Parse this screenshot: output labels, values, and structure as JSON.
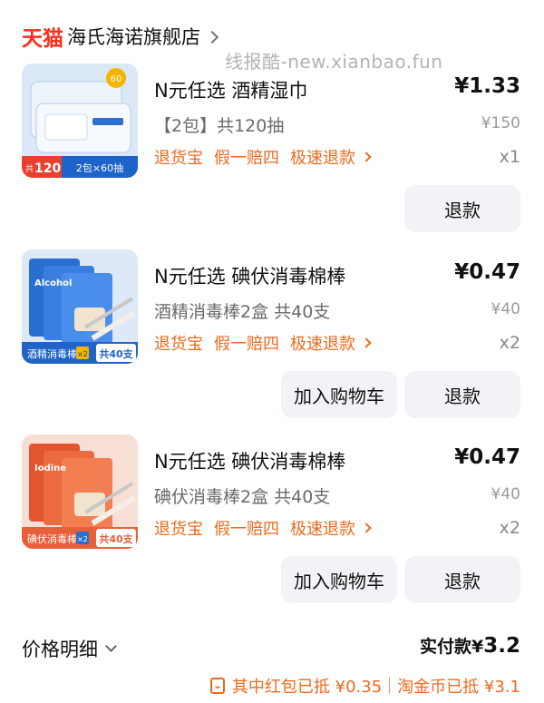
{
  "store": {
    "brand": "天猫",
    "name": "海氏海诺旗舰店"
  },
  "watermark": "线报酷-new.xianbao.fun",
  "items": [
    {
      "title": "N元任选 酒精湿巾",
      "price": "¥1.33",
      "spec": "【2包】共120抽",
      "orig_price": "¥150",
      "services": [
        "退货宝",
        "假一赔四",
        "极速退款"
      ],
      "qty": "x1",
      "refund_label": "退款",
      "thumb": {
        "badge": "60",
        "corner_tag": "120",
        "corner_prefix": "共",
        "corner_suffix": "抽",
        "pack_text": "2包×60抽",
        "bg": "#dbe9f7",
        "accent": "#1d63c9"
      }
    },
    {
      "title": "N元任选 碘伏消毒棉棒",
      "price": "¥0.47",
      "spec": "酒精消毒棒2盒 共40支",
      "orig_price": "¥40",
      "services": [
        "退货宝",
        "假一赔四",
        "极速退款"
      ],
      "qty": "x2",
      "cart_label": "加入购物车",
      "refund_label": "退款",
      "thumb": {
        "box_text": "Alcohol",
        "tag_left": "酒精消毒棒",
        "tag_x": "×2",
        "tag_right": "共40支",
        "bg": "#dde9f6",
        "accent": "#1f64c6"
      }
    },
    {
      "title": "N元任选 碘伏消毒棉棒",
      "price": "¥0.47",
      "spec": "碘伏消毒棒2盒 共40支",
      "orig_price": "¥40",
      "services": [
        "退货宝",
        "假一赔四",
        "极速退款"
      ],
      "qty": "x2",
      "cart_label": "加入购物车",
      "refund_label": "退款",
      "thumb": {
        "box_text": "Iodine",
        "tag_left": "碘伏消毒棒",
        "tag_x": "×2",
        "tag_right": "共40支",
        "bg": "#f8dfd6",
        "accent": "#e8603a"
      }
    }
  ],
  "price_detail": {
    "label": "价格明细",
    "paid_label": "实付款",
    "paid_currency": "¥",
    "paid_amount": "3.2",
    "discounts": [
      "其中红包已抵 ¥0.35",
      "淘金币已抵 ¥3.1"
    ]
  },
  "colors": {
    "brand_red": "#ff2d1a",
    "service_orange": "#ee6a1b",
    "button_bg": "#f2f3f6"
  }
}
